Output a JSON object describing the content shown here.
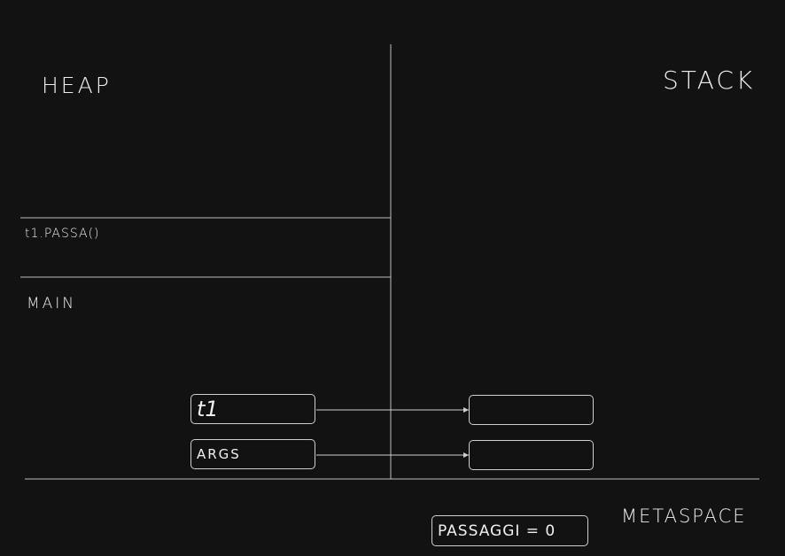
{
  "regions": {
    "heap": "HEAP",
    "stack": "STACK",
    "metaspace": "METASPACE"
  },
  "frames": {
    "t1_passa": "t1.PASSA()",
    "main": "MAIN"
  },
  "variables": {
    "t1": "t1",
    "args": "ARGS"
  },
  "static_field": "PASSAGGI = 0",
  "colors": {
    "background": "#121212",
    "stroke": "#cfcfcf",
    "text": "#ededed"
  }
}
